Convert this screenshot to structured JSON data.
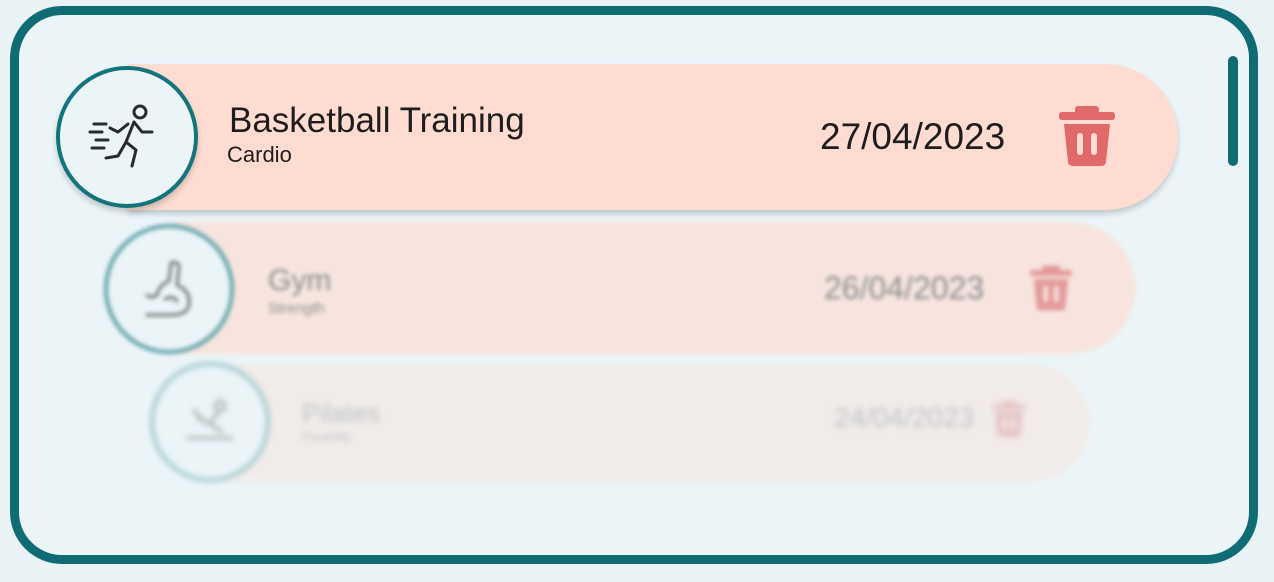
{
  "colors": {
    "frame_border": "#0f6b74",
    "background": "#ebf5f8",
    "card": "#fedcd1",
    "trash": "#e06a69"
  },
  "workouts": [
    {
      "name": "Basketball Training",
      "category": "Cardio",
      "date": "27/04/2023",
      "icon": "running-icon",
      "delete_icon": "trash-icon"
    },
    {
      "name": "Gym",
      "category": "Strength",
      "date": "26/04/2023",
      "icon": "flexed-arm-icon",
      "delete_icon": "trash-icon"
    },
    {
      "name": "Pilates",
      "category": "Flexibility",
      "date": "24/04/2023",
      "icon": "pilates-pose-icon",
      "delete_icon": "trash-icon"
    }
  ]
}
